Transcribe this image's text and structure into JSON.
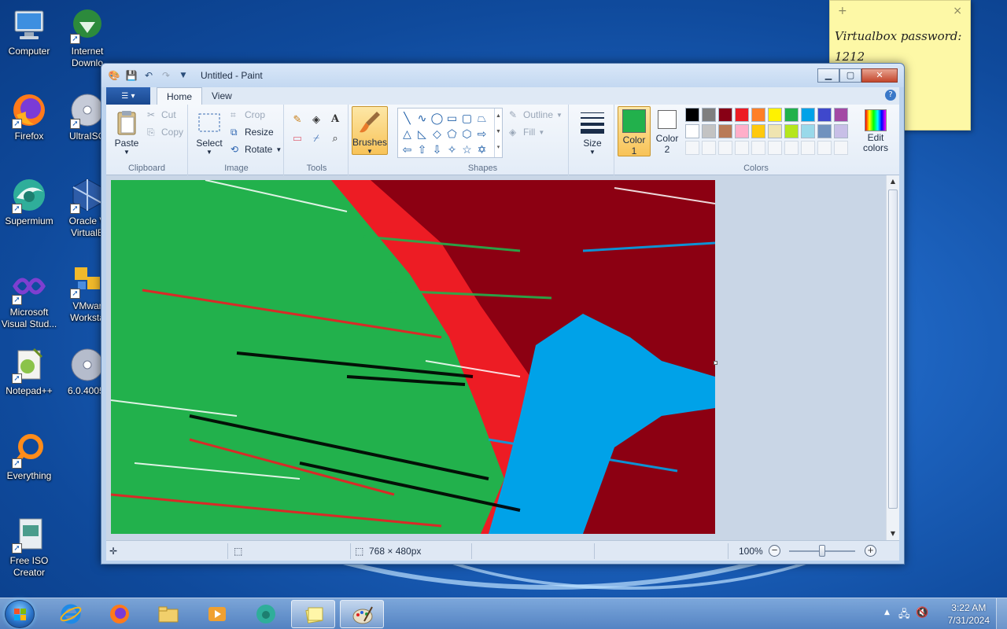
{
  "desktop": {
    "icons": [
      {
        "label": "Computer",
        "icon": "computer-icon"
      },
      {
        "label": "Internet\nDownlo",
        "icon": "download-manager-icon"
      },
      {
        "label": "Firefox",
        "icon": "firefox-icon"
      },
      {
        "label": "UltraISO",
        "icon": "disc-icon"
      },
      {
        "label": "Supermium",
        "icon": "supermium-icon"
      },
      {
        "label": "Oracle V\nVirtualB",
        "icon": "virtualbox-icon"
      },
      {
        "label": "Microsoft\nVisual Stud...",
        "icon": "visual-studio-icon"
      },
      {
        "label": "VMwar\nWorksta",
        "icon": "vmware-icon"
      },
      {
        "label": "Notepad++",
        "icon": "notepadpp-icon"
      },
      {
        "label": "6.0.4005.",
        "icon": "disc-icon"
      },
      {
        "label": "Everything",
        "icon": "search-everything-icon"
      },
      {
        "label": "Free ISO\nCreator",
        "icon": "iso-creator-icon"
      }
    ]
  },
  "sticky_note": {
    "add": "+",
    "close": "×",
    "text": "Virtualbox password:\n1212"
  },
  "window": {
    "title": "Untitled - Paint",
    "buttons": {
      "minimize": "▁",
      "maximize": "▢",
      "close": "✕"
    }
  },
  "ribbon": {
    "tabs": [
      "Home",
      "View"
    ],
    "active_tab": "Home",
    "help": "?",
    "clipboard": {
      "paste": "Paste",
      "cut": "Cut",
      "copy": "Copy",
      "label": "Clipboard"
    },
    "image": {
      "select": "Select",
      "crop": "Crop",
      "resize": "Resize",
      "rotate": "Rotate",
      "label": "Image"
    },
    "tools": {
      "label": "Tools"
    },
    "brushes": "Brushes",
    "shapes": {
      "outline": "Outline",
      "fill": "Fill",
      "label": "Shapes"
    },
    "size": "Size",
    "color1": {
      "label": "Color",
      "sub": "1",
      "value": "#22b14c"
    },
    "color2": {
      "label": "Color",
      "sub": "2",
      "value": "#ffffff"
    },
    "edit_colors": "Edit\ncolors",
    "colors_label": "Colors",
    "palette_row1": [
      "#000000",
      "#7f7f7f",
      "#880015",
      "#ed1c24",
      "#ff7f27",
      "#fff200",
      "#22b14c",
      "#00a2e8",
      "#3f48cc",
      "#a349a4"
    ],
    "palette_row2": [
      "#ffffff",
      "#c3c3c3",
      "#b97a57",
      "#ffaec9",
      "#ffc90e",
      "#efe4b0",
      "#b5e61d",
      "#99d9ea",
      "#7092be",
      "#c8bfe7"
    ]
  },
  "statusbar": {
    "dimensions": "768 × 480px",
    "zoom": "100%",
    "zoom_fraction": 0.5
  },
  "taskbar": {
    "items": [
      "internet-explorer-icon",
      "firefox-icon",
      "file-explorer-icon",
      "media-player-icon",
      "supermium-icon",
      "sticky-notes-icon",
      "paint-icon"
    ],
    "time": "3:22 AM",
    "date": "7/31/2024"
  }
}
